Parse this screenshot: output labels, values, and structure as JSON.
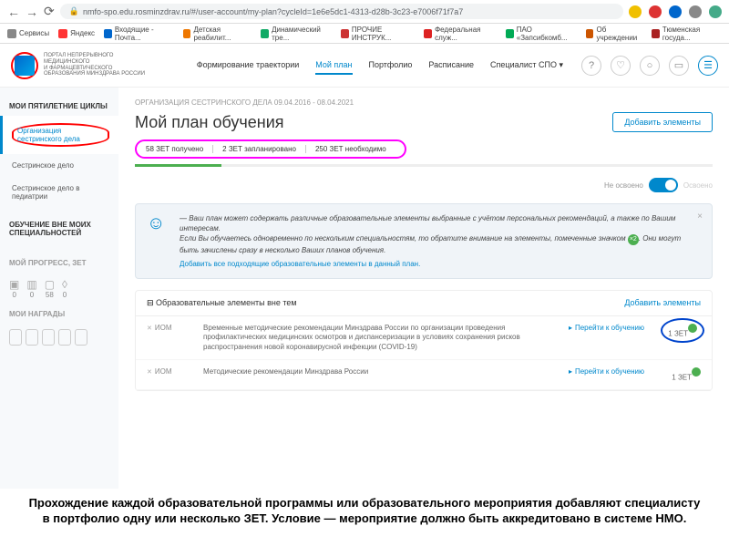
{
  "url": "nmfo-spo.edu.rosminzdrav.ru/#/user-account/my-plan?cycleId=1e6e5dc1-4313-d28b-3c23-e7006f71f7a7",
  "bookmarks": [
    "Сервисы",
    "Яндекс",
    "Входящие - Почта...",
    "Детская реабилит...",
    "Динамический тре...",
    "ПРОЧИЕ ИНСТРУК...",
    "Федеральная служ...",
    "ПАО «Запсибкомб...",
    "Об учреждении",
    "Тюменская госуда..."
  ],
  "logo_text": "ПОРТАЛ НЕПРЕРЫВНОГО\nМЕДИЦИНСКОГО\nИ ФАРМАЦЕВТИЧЕСКОГО\nОБРАЗОВАНИЯ МИНЗДРАВА РОССИИ",
  "nav": [
    "Формирование траектории",
    "Мой план",
    "Портфолио",
    "Расписание",
    "Специалист СПО ▾"
  ],
  "nav_active": 1,
  "sidebar": {
    "title1": "МОИ ПЯТИЛЕТНИЕ ЦИКЛЫ",
    "items": [
      "Организация сестринского дела",
      "Сестринское дело",
      "Сестринское дело в педиатрии"
    ],
    "title2": "ОБУЧЕНИЕ ВНЕ МОИХ СПЕЦИАЛЬНОСТЕЙ",
    "title3": "МОЙ ПРОГРЕСС, ЗЕТ",
    "progress": [
      {
        "v": "0"
      },
      {
        "v": "0"
      },
      {
        "v": "58"
      },
      {
        "v": "0"
      }
    ],
    "title4": "МОИ НАГРАДЫ"
  },
  "breadcrumb": "ОРГАНИЗАЦИЯ СЕСТРИНСКОГО ДЕЛА 09.04.2016 - 08.04.2021",
  "page_title": "Мой план обучения",
  "add_button": "Добавить элементы",
  "zet": [
    "58 ЗЕТ получено",
    "2 ЗЕТ запланировано",
    "250 ЗЕТ необходимо"
  ],
  "toggle": {
    "left": "Не освоено",
    "right": "Освоено"
  },
  "info": {
    "l1": "— Ваш план может содержать различные образовательные элементы выбранные с учётом персональных рекомендаций, а также по Вашим интересам.",
    "l2a": "Если Вы обучаетесь одновременно по нескольким специальностям, то обратите внимание на элементы, помеченные значком ",
    "l2b": ". Они могут быть зачислены сразу в несколько Ваших планов обучения.",
    "link": "Добавить все подходящие образовательные элементы в данный план."
  },
  "elements": {
    "title": "Образовательные элементы вне тем",
    "add": "Добавить элементы",
    "rows": [
      {
        "type": "ИОМ",
        "desc": "Временные методические рекомендации Минздрава России по организации проведения профилактических медицинских осмотров и диспансеризации в условиях сохранения рисков распространения новой коронавирусной инфекции (COVID-19)",
        "action": "Перейти к обучению",
        "zet": "1 ЗЕТ"
      },
      {
        "type": "ИОМ",
        "desc": "Методические рекомендации Минздрава России",
        "action": "Перейти к обучению",
        "zet": "1 ЗЕТ"
      }
    ]
  },
  "caption": "Прохождение каждой образовательной программы или образовательного мероприятия добавляют специалисту в портфолио одну или несколько ЗЕТ. Условие — мероприятие должно быть аккредитовано в системе НМО."
}
